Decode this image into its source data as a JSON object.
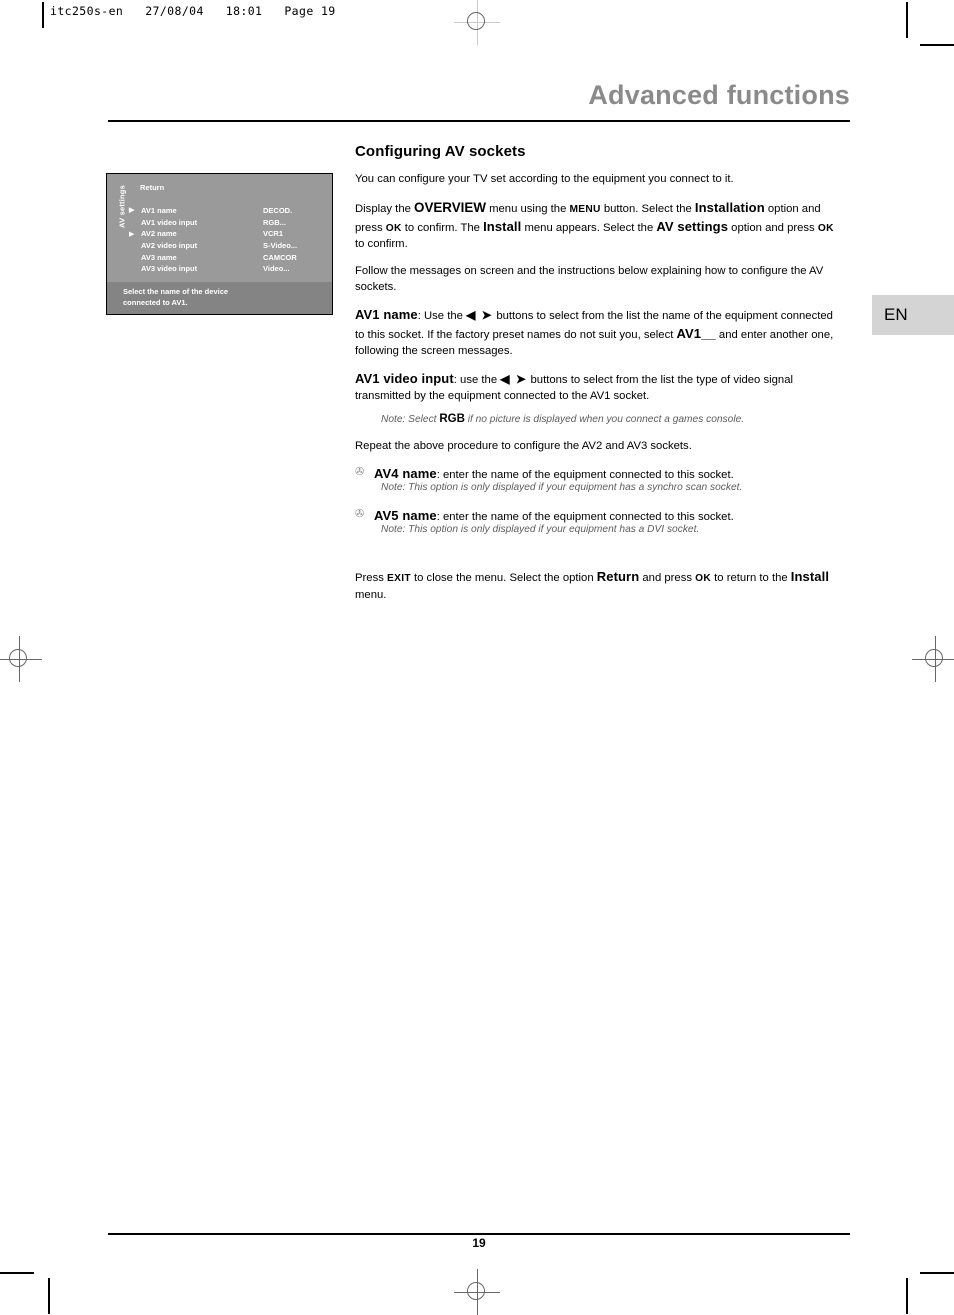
{
  "print_stamp": "itc250s-en   27/08/04   18:01   Page 19",
  "header": {
    "title": "Advanced functions"
  },
  "language_tab": {
    "label": "EN"
  },
  "osd": {
    "side_label": "AV settings",
    "return_label": "Return",
    "caret": "▶",
    "rows": [
      {
        "selected": true,
        "label": "AV1 name",
        "value": "DECOD."
      },
      {
        "selected": false,
        "label": "AV1 video input",
        "value": "RGB..."
      },
      {
        "selected": false,
        "label": "AV2 name",
        "value": "VCR1"
      },
      {
        "selected": false,
        "label": "AV2 video input",
        "value": "S-Video..."
      },
      {
        "selected": false,
        "label": "AV3 name",
        "value": "CAMCOR"
      },
      {
        "selected": false,
        "label": "AV3 video input",
        "value": "Video..."
      }
    ],
    "hint_line1": "Select the name of the device",
    "hint_line2": "connected to AV1."
  },
  "content": {
    "section_heading": "Configuring AV sockets",
    "intro": "You can configure your TV set according to the equipment you connect to it.",
    "overview_p1": "Display the ",
    "overview_term": "OVERVIEW",
    "overview_p2": " menu using the ",
    "overview_menu_key": "MENU",
    "overview_p3": " button. Select the ",
    "overview_installation": "Installation",
    "overview_p4": " option and press ",
    "overview_ok1": "OK",
    "overview_p5": " to confirm. The ",
    "overview_install": "Install",
    "overview_p6": " menu appears. Select the ",
    "overview_avsettings": "AV settings",
    "overview_p7": " option and press ",
    "overview_ok2": "OK",
    "overview_p8": " to confirm.",
    "follow": "Follow the messages on screen and the instructions below explaining how to configure the AV sockets.",
    "av1name_term": "AV1 name",
    "av1name_p1": ": Use the ",
    "av1name_arrows": "◀ ➤",
    "av1name_p2": " buttons to select from the list the name of the equipment connected to this socket. If the factory preset names do not suit you, select ",
    "av1name_select": "AV1__",
    "av1name_p3": " and enter another one, following the screen messages.",
    "av1video_term": "AV1 video input",
    "av1video_p1": ": use the ",
    "av1video_arrows": "◀ ➤",
    "av1video_p2": " buttons to select from the list the type of video signal transmitted by the equipment connected to the AV1 socket.",
    "note_rgb_pre": "Note: Select ",
    "note_rgb_bold": "RGB",
    "note_rgb_post": " if no picture is displayed when you connect a games console.",
    "repeat": "Repeat the above procedure to configure the AV2 and AV3 sockets.",
    "bullet_glyph": "✇",
    "av4name_term": "AV4 name",
    "av4name_rest": ": enter the name of the equipment connected to this socket.",
    "note_av4": "Note: This option is only displayed if your equipment has a synchro scan socket.",
    "av5name_term": "AV5 name",
    "av5name_rest": ": enter the name of the equipment connected to this socket.",
    "note_av5": "Note: This option is only displayed if your equipment has a DVI socket.",
    "closing_p1": "Press ",
    "closing_exit": "EXIT",
    "closing_p2": " to close the menu. Select the option ",
    "closing_return": "Return",
    "closing_p3": " and press ",
    "closing_ok": "OK",
    "closing_p4": " to return to the ",
    "closing_install": "Install",
    "closing_p5": " menu."
  },
  "footer": {
    "page_number": "19"
  }
}
